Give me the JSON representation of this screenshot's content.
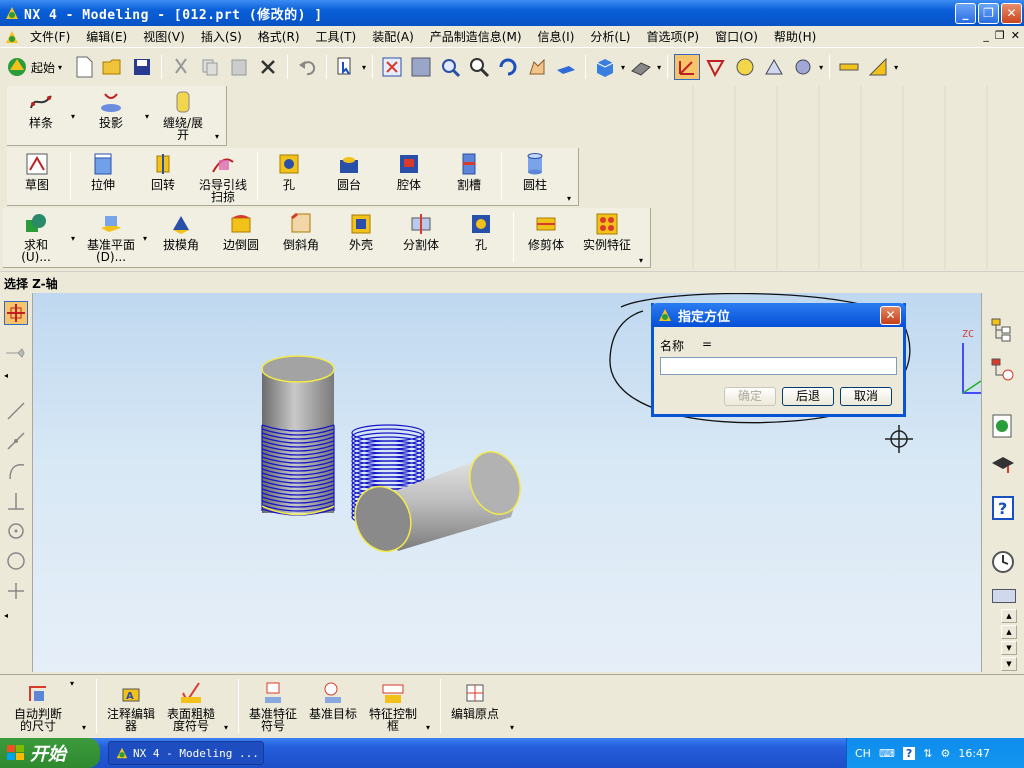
{
  "window": {
    "title": "NX 4 - Modeling - [012.prt (修改的) ]"
  },
  "menu": [
    "文件(F)",
    "编辑(E)",
    "视图(V)",
    "插入(S)",
    "格式(R)",
    "工具(T)",
    "装配(A)",
    "产品制造信息(M)",
    "信息(I)",
    "分析(L)",
    "首选项(P)",
    "窗口(O)",
    "帮助(H)"
  ],
  "toolbar": {
    "start_label": "起始"
  },
  "curve_group": [
    "样条",
    "投影",
    "缠绕/展开"
  ],
  "feature_group": [
    "草图",
    "拉伸",
    "回转",
    "沿导引线扫掠",
    "孔",
    "圆台",
    "腔体",
    "割槽",
    "圆柱"
  ],
  "feature_ops": [
    "求和(U)...",
    "基准平面(D)...",
    "拔模角",
    "边倒圆",
    "倒斜角",
    "外壳",
    "分割体",
    "孔",
    "修剪体",
    "实例特征"
  ],
  "status": {
    "prompt": "选择 Z-轴"
  },
  "dialog": {
    "title": "指定方位",
    "name_label": "名称",
    "equals": "=",
    "input_value": "",
    "ok_label": "确定",
    "back_label": "后退",
    "cancel_label": "取消"
  },
  "viewport": {
    "axis_label": "ZC"
  },
  "annotation_group": [
    "自动判断的尺寸",
    "注释编辑器",
    "表面粗糙度符号",
    "基准特征符号",
    "基准目标",
    "特征控制框",
    "编辑原点"
  ],
  "taskbar": {
    "start_label": "开始",
    "task_label": "NX 4 - Modeling ...",
    "lang": "CH",
    "clock": "16:47"
  }
}
